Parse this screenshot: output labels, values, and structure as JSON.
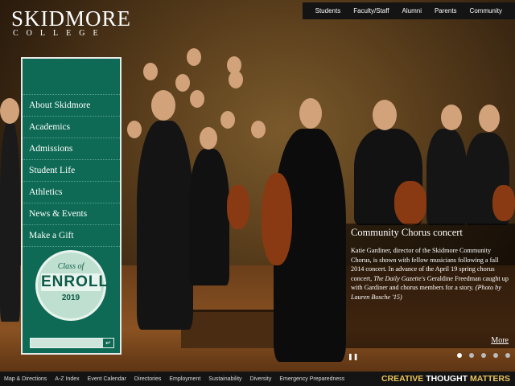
{
  "brand": {
    "name": "SKIDMORE",
    "sub": "COLLEGE"
  },
  "topnav": [
    "Students",
    "Faculty/Staff",
    "Alumni",
    "Parents",
    "Community"
  ],
  "menu": [
    "About Skidmore",
    "Academics",
    "Admissions",
    "Student Life",
    "Athletics",
    "News & Events",
    "Make a Gift"
  ],
  "badge": {
    "line1": "Class of",
    "line2": "ENROLL",
    "line3": "2019"
  },
  "search": {
    "placeholder": ""
  },
  "caption": {
    "title": "Community Chorus concert",
    "body_1": "Katie Gardiner, director of the Skidmore Community Chorus, is shown with fellow musicians following a fall 2014 concert. In advance of the April 19 spring chorus concert,",
    "body_italic": "The Daily Gazette's",
    "body_2": "Geraldine Freedman caught up with Gardiner and chorus members for a story.",
    "body_credit": "(Photo by Lauren Bosche '15)",
    "more": "More"
  },
  "slideshow": {
    "slides": 5,
    "active": 0
  },
  "footer": [
    "Map & Directions",
    "A-Z Index",
    "Event Calendar",
    "Directories",
    "Employment",
    "Sustainability",
    "Diversity",
    "Emergency Preparedness"
  ],
  "tagline": {
    "w1": "CREATIVE",
    "w2": "THOUGHT",
    "w3": "MATTERS",
    "c1": "#e8c45a",
    "c2": "#ffffff",
    "c3": "#e8c45a"
  },
  "colors": {
    "panel": "#0e6a55",
    "nav_bg": "#141414"
  },
  "icons": {
    "pause": "pause-icon",
    "search_go": "enter-icon"
  }
}
